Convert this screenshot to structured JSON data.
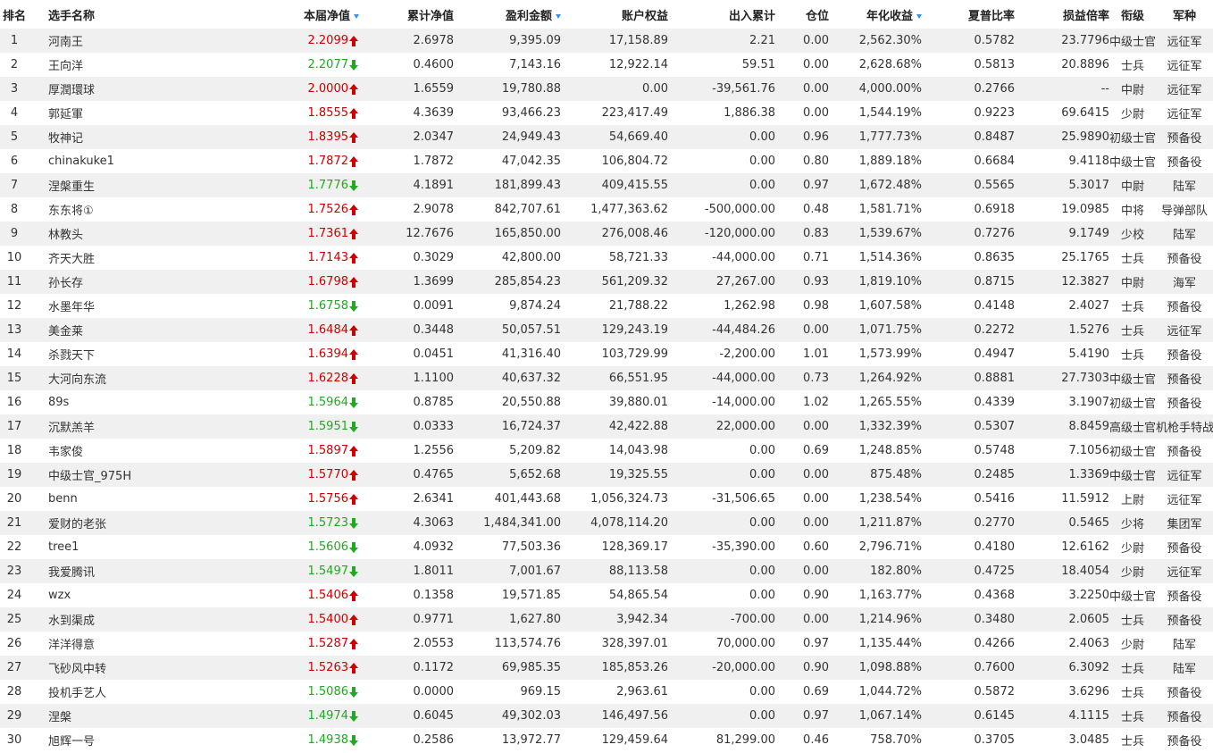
{
  "headers": {
    "rank": "排名",
    "name": "选手名称",
    "nav": "本届净值",
    "cum_nav": "累计净值",
    "profit": "盈利金额",
    "equity": "账户权益",
    "flow": "出入累计",
    "position": "仓位",
    "annual": "年化收益",
    "sharpe": "夏普比率",
    "pl_ratio": "损益倍率",
    "title": "衔级",
    "army": "军种"
  },
  "colors": {
    "up": "#cc0000",
    "down": "#22a822",
    "sort_arrow": "#3a8ee6",
    "stripe": "#f0f0f0"
  },
  "rows": [
    {
      "rank": "1",
      "name": "河南王",
      "nav": "2.2099",
      "dir": "up",
      "cum_nav": "2.6978",
      "profit": "9,395.09",
      "equity": "17,158.89",
      "flow": "2.21",
      "position": "0.00",
      "annual": "2,562.30%",
      "sharpe": "0.5782",
      "pl_ratio": "23.7796",
      "title": "中级士官",
      "army": "远征军"
    },
    {
      "rank": "2",
      "name": "王向洋",
      "nav": "2.2077",
      "dir": "down",
      "cum_nav": "0.4600",
      "profit": "7,143.16",
      "equity": "12,922.14",
      "flow": "59.51",
      "position": "0.00",
      "annual": "2,628.68%",
      "sharpe": "0.5813",
      "pl_ratio": "20.8896",
      "title": "士兵",
      "army": "远征军"
    },
    {
      "rank": "3",
      "name": "厚潤環球",
      "nav": "2.0000",
      "dir": "up",
      "cum_nav": "1.6559",
      "profit": "19,780.88",
      "equity": "0.00",
      "flow": "-39,561.76",
      "position": "0.00",
      "annual": "4,000.00%",
      "sharpe": "0.2766",
      "pl_ratio": "--",
      "title": "中尉",
      "army": "远征军"
    },
    {
      "rank": "4",
      "name": "郭延軍",
      "nav": "1.8555",
      "dir": "up",
      "cum_nav": "4.3639",
      "profit": "93,466.23",
      "equity": "223,417.49",
      "flow": "1,886.38",
      "position": "0.00",
      "annual": "1,544.19%",
      "sharpe": "0.9223",
      "pl_ratio": "69.6415",
      "title": "少尉",
      "army": "远征军"
    },
    {
      "rank": "5",
      "name": "牧神记",
      "nav": "1.8395",
      "dir": "up",
      "cum_nav": "2.0347",
      "profit": "24,949.43",
      "equity": "54,669.40",
      "flow": "0.00",
      "position": "0.96",
      "annual": "1,777.73%",
      "sharpe": "0.8487",
      "pl_ratio": "25.9890",
      "title": "初级士官",
      "army": "预备役"
    },
    {
      "rank": "6",
      "name": "chinakuke1",
      "nav": "1.7872",
      "dir": "up",
      "cum_nav": "1.7872",
      "profit": "47,042.35",
      "equity": "106,804.72",
      "flow": "0.00",
      "position": "0.80",
      "annual": "1,889.18%",
      "sharpe": "0.6684",
      "pl_ratio": "9.4118",
      "title": "中级士官",
      "army": "预备役"
    },
    {
      "rank": "7",
      "name": "涅槃重生",
      "nav": "1.7776",
      "dir": "down",
      "cum_nav": "4.1891",
      "profit": "181,899.43",
      "equity": "409,415.55",
      "flow": "0.00",
      "position": "0.97",
      "annual": "1,672.48%",
      "sharpe": "0.5565",
      "pl_ratio": "5.3017",
      "title": "中尉",
      "army": "陆军"
    },
    {
      "rank": "8",
      "name": "东东将①",
      "nav": "1.7526",
      "dir": "up",
      "cum_nav": "2.9078",
      "profit": "842,707.61",
      "equity": "1,477,363.62",
      "flow": "-500,000.00",
      "position": "0.48",
      "annual": "1,581.71%",
      "sharpe": "0.6918",
      "pl_ratio": "19.0985",
      "title": "中将",
      "army": "导弹部队"
    },
    {
      "rank": "9",
      "name": "林教头",
      "nav": "1.7361",
      "dir": "up",
      "cum_nav": "12.7676",
      "profit": "165,850.00",
      "equity": "276,008.46",
      "flow": "-120,000.00",
      "position": "0.83",
      "annual": "1,539.67%",
      "sharpe": "0.7276",
      "pl_ratio": "9.1749",
      "title": "少校",
      "army": "陆军"
    },
    {
      "rank": "10",
      "name": "齐天大胜",
      "nav": "1.7143",
      "dir": "up",
      "cum_nav": "0.3029",
      "profit": "42,800.00",
      "equity": "58,721.33",
      "flow": "-44,000.00",
      "position": "0.71",
      "annual": "1,514.36%",
      "sharpe": "0.8635",
      "pl_ratio": "25.1765",
      "title": "士兵",
      "army": "预备役"
    },
    {
      "rank": "11",
      "name": "孙长存",
      "nav": "1.6798",
      "dir": "up",
      "cum_nav": "1.3699",
      "profit": "285,854.23",
      "equity": "561,209.32",
      "flow": "27,267.00",
      "position": "0.93",
      "annual": "1,819.10%",
      "sharpe": "0.8715",
      "pl_ratio": "12.3827",
      "title": "中尉",
      "army": "海军"
    },
    {
      "rank": "12",
      "name": "水墨年华",
      "nav": "1.6758",
      "dir": "down",
      "cum_nav": "0.0091",
      "profit": "9,874.24",
      "equity": "21,788.22",
      "flow": "1,262.98",
      "position": "0.98",
      "annual": "1,607.58%",
      "sharpe": "0.4148",
      "pl_ratio": "2.4027",
      "title": "士兵",
      "army": "预备役"
    },
    {
      "rank": "13",
      "name": "美金莱",
      "nav": "1.6484",
      "dir": "up",
      "cum_nav": "0.3448",
      "profit": "50,057.51",
      "equity": "129,243.19",
      "flow": "-44,484.26",
      "position": "0.00",
      "annual": "1,071.75%",
      "sharpe": "0.2272",
      "pl_ratio": "1.5276",
      "title": "士兵",
      "army": "远征军"
    },
    {
      "rank": "14",
      "name": "杀戮天下",
      "nav": "1.6394",
      "dir": "up",
      "cum_nav": "0.0451",
      "profit": "41,316.40",
      "equity": "103,729.99",
      "flow": "-2,200.00",
      "position": "1.01",
      "annual": "1,573.99%",
      "sharpe": "0.4947",
      "pl_ratio": "5.4190",
      "title": "士兵",
      "army": "预备役"
    },
    {
      "rank": "15",
      "name": "大河向东流",
      "nav": "1.6228",
      "dir": "up",
      "cum_nav": "1.1100",
      "profit": "40,637.32",
      "equity": "66,551.95",
      "flow": "-44,000.00",
      "position": "0.73",
      "annual": "1,264.92%",
      "sharpe": "0.8881",
      "pl_ratio": "27.7303",
      "title": "中级士官",
      "army": "预备役"
    },
    {
      "rank": "16",
      "name": "89s",
      "nav": "1.5964",
      "dir": "down",
      "cum_nav": "0.8785",
      "profit": "20,550.88",
      "equity": "39,880.01",
      "flow": "-14,000.00",
      "position": "1.02",
      "annual": "1,265.55%",
      "sharpe": "0.4339",
      "pl_ratio": "3.1907",
      "title": "初级士官",
      "army": "预备役"
    },
    {
      "rank": "17",
      "name": "沉默羔羊",
      "nav": "1.5951",
      "dir": "down",
      "cum_nav": "0.0333",
      "profit": "16,724.37",
      "equity": "42,422.88",
      "flow": "22,000.00",
      "position": "0.00",
      "annual": "1,332.39%",
      "sharpe": "0.5307",
      "pl_ratio": "8.8459",
      "title": "高级士官",
      "army": "机枪手特战"
    },
    {
      "rank": "18",
      "name": "韦家俊",
      "nav": "1.5897",
      "dir": "up",
      "cum_nav": "1.2556",
      "profit": "5,209.82",
      "equity": "14,043.98",
      "flow": "0.00",
      "position": "0.69",
      "annual": "1,248.85%",
      "sharpe": "0.5748",
      "pl_ratio": "7.1056",
      "title": "初级士官",
      "army": "预备役"
    },
    {
      "rank": "19",
      "name": "中级士官_975H",
      "nav": "1.5770",
      "dir": "up",
      "cum_nav": "0.4765",
      "profit": "5,652.68",
      "equity": "19,325.55",
      "flow": "0.00",
      "position": "0.00",
      "annual": "875.48%",
      "sharpe": "0.2485",
      "pl_ratio": "1.3369",
      "title": "中级士官",
      "army": "远征军"
    },
    {
      "rank": "20",
      "name": "benn",
      "nav": "1.5756",
      "dir": "up",
      "cum_nav": "2.6341",
      "profit": "401,443.68",
      "equity": "1,056,324.73",
      "flow": "-31,506.65",
      "position": "0.00",
      "annual": "1,238.54%",
      "sharpe": "0.5416",
      "pl_ratio": "11.5912",
      "title": "上尉",
      "army": "远征军"
    },
    {
      "rank": "21",
      "name": "爱财的老张",
      "nav": "1.5723",
      "dir": "down",
      "cum_nav": "4.3063",
      "profit": "1,484,341.00",
      "equity": "4,078,114.20",
      "flow": "0.00",
      "position": "0.00",
      "annual": "1,211.87%",
      "sharpe": "0.2770",
      "pl_ratio": "0.5465",
      "title": "少将",
      "army": "集团军"
    },
    {
      "rank": "22",
      "name": "tree1",
      "nav": "1.5606",
      "dir": "down",
      "cum_nav": "4.0932",
      "profit": "77,503.36",
      "equity": "128,369.17",
      "flow": "-35,390.00",
      "position": "0.60",
      "annual": "2,796.71%",
      "sharpe": "0.4180",
      "pl_ratio": "12.6162",
      "title": "少尉",
      "army": "预备役"
    },
    {
      "rank": "23",
      "name": "我爱腾讯",
      "nav": "1.5497",
      "dir": "down",
      "cum_nav": "1.8011",
      "profit": "7,001.67",
      "equity": "88,113.58",
      "flow": "0.00",
      "position": "0.00",
      "annual": "182.80%",
      "sharpe": "0.4725",
      "pl_ratio": "18.4054",
      "title": "少尉",
      "army": "远征军"
    },
    {
      "rank": "24",
      "name": "wzx",
      "nav": "1.5406",
      "dir": "up",
      "cum_nav": "0.1358",
      "profit": "19,571.85",
      "equity": "54,865.54",
      "flow": "0.00",
      "position": "0.90",
      "annual": "1,163.77%",
      "sharpe": "0.4368",
      "pl_ratio": "3.2250",
      "title": "中级士官",
      "army": "预备役"
    },
    {
      "rank": "25",
      "name": "水到渠成",
      "nav": "1.5400",
      "dir": "up",
      "cum_nav": "0.9771",
      "profit": "1,627.80",
      "equity": "3,942.34",
      "flow": "-700.00",
      "position": "0.00",
      "annual": "1,214.96%",
      "sharpe": "0.3480",
      "pl_ratio": "2.0605",
      "title": "士兵",
      "army": "预备役"
    },
    {
      "rank": "26",
      "name": "洋洋得意",
      "nav": "1.5287",
      "dir": "up",
      "cum_nav": "2.0553",
      "profit": "113,574.76",
      "equity": "328,397.01",
      "flow": "70,000.00",
      "position": "0.97",
      "annual": "1,135.44%",
      "sharpe": "0.4266",
      "pl_ratio": "2.4063",
      "title": "少尉",
      "army": "陆军"
    },
    {
      "rank": "27",
      "name": "飞砂风中转",
      "nav": "1.5263",
      "dir": "up",
      "cum_nav": "0.1172",
      "profit": "69,985.35",
      "equity": "185,853.26",
      "flow": "-20,000.00",
      "position": "0.90",
      "annual": "1,098.88%",
      "sharpe": "0.7600",
      "pl_ratio": "6.3092",
      "title": "士兵",
      "army": "陆军"
    },
    {
      "rank": "28",
      "name": "投机手艺人",
      "nav": "1.5086",
      "dir": "down",
      "cum_nav": "0.0000",
      "profit": "969.15",
      "equity": "2,963.61",
      "flow": "0.00",
      "position": "0.69",
      "annual": "1,044.72%",
      "sharpe": "0.5872",
      "pl_ratio": "3.6296",
      "title": "士兵",
      "army": "预备役"
    },
    {
      "rank": "29",
      "name": "涅槃",
      "nav": "1.4974",
      "dir": "down",
      "cum_nav": "0.6045",
      "profit": "49,302.03",
      "equity": "146,497.56",
      "flow": "0.00",
      "position": "0.97",
      "annual": "1,067.14%",
      "sharpe": "0.6145",
      "pl_ratio": "4.1115",
      "title": "士兵",
      "army": "预备役"
    },
    {
      "rank": "30",
      "name": "旭辉一号",
      "nav": "1.4938",
      "dir": "down",
      "cum_nav": "0.2586",
      "profit": "13,972.77",
      "equity": "129,459.64",
      "flow": "81,299.00",
      "position": "0.46",
      "annual": "758.70%",
      "sharpe": "0.3705",
      "pl_ratio": "3.0485",
      "title": "士兵",
      "army": "预备役"
    }
  ]
}
